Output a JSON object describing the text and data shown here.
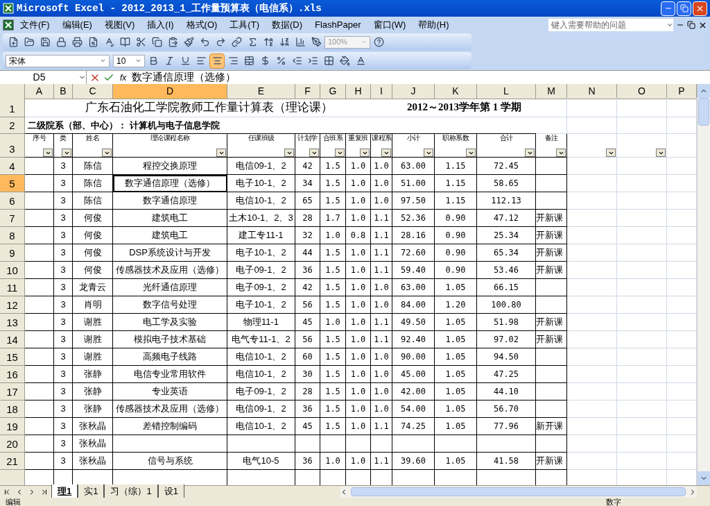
{
  "window": {
    "title": "Microsoft Excel - 2012_2013_1_工作量预算表（电信系）.xls"
  },
  "menu": [
    "文件(F)",
    "编辑(E)",
    "视图(V)",
    "插入(I)",
    "格式(O)",
    "工具(T)",
    "数据(D)",
    "FlashPaper",
    "窗口(W)",
    "帮助(H)"
  ],
  "help_search": {
    "placeholder": "键入需要帮助的问题"
  },
  "standard_toolbar": {
    "zoom": "100%"
  },
  "format_toolbar": {
    "font": "宋体",
    "size": "10",
    "buttons": [
      {
        "kind": "bold",
        "selected": false
      },
      {
        "kind": "italic",
        "selected": false
      },
      {
        "kind": "underline",
        "selected": false
      },
      {
        "kind": "align-left",
        "selected": false
      },
      {
        "kind": "align-center",
        "selected": true
      },
      {
        "kind": "align-right",
        "selected": false
      },
      {
        "kind": "merge",
        "selected": false
      },
      {
        "kind": "currency",
        "selected": false
      },
      {
        "kind": "percent",
        "selected": false
      },
      {
        "kind": "outdent",
        "selected": false
      },
      {
        "kind": "indent",
        "selected": false
      },
      {
        "kind": "borders",
        "selected": false
      },
      {
        "kind": "fill-color",
        "selected": false
      },
      {
        "kind": "font-color",
        "selected": false
      }
    ]
  },
  "formula_bar": {
    "name_box": "D5",
    "fx": "fx",
    "formula": "数字通信原理（选修）"
  },
  "columns": [
    {
      "label": "A",
      "selected": false
    },
    {
      "label": "B",
      "selected": false
    },
    {
      "label": "C",
      "selected": false
    },
    {
      "label": "D",
      "selected": true
    },
    {
      "label": "E",
      "selected": false
    },
    {
      "label": "F",
      "selected": false
    },
    {
      "label": "G",
      "selected": false
    },
    {
      "label": "H",
      "selected": false
    },
    {
      "label": "I",
      "selected": false
    },
    {
      "label": "J",
      "selected": false
    },
    {
      "label": "K",
      "selected": false
    },
    {
      "label": "L",
      "selected": false
    },
    {
      "label": "M",
      "selected": false
    },
    {
      "label": "N",
      "selected": false
    },
    {
      "label": "O",
      "selected": false
    },
    {
      "label": "P",
      "selected": false
    }
  ],
  "title_row": {
    "row": "1",
    "selected": false,
    "title": "广东石油化工学院教师工作量计算表（理论课）",
    "term": "2012～2013学年第 1 学期"
  },
  "department_row": {
    "row": "2",
    "selected": false,
    "text": "二级院系（部、中心）： 计算机与电子信息学院"
  },
  "header_row": {
    "row": "3",
    "selected": false,
    "cells": [
      {
        "text": "序号",
        "filter": true
      },
      {
        "text": "类",
        "filter": true
      },
      {
        "text": "姓名",
        "filter": true
      },
      {
        "text": "理论课程名称",
        "filter": true
      },
      {
        "text": "任课班级",
        "filter": true
      },
      {
        "text": "计划学",
        "filter": true
      },
      {
        "text": "合班系",
        "filter": true
      },
      {
        "text": "重复班",
        "filter": true
      },
      {
        "text": "课程系",
        "filter": true
      },
      {
        "text": "小计",
        "filter": true
      },
      {
        "text": "职称系数",
        "filter": true
      },
      {
        "text": "合计",
        "filter": true
      },
      {
        "text": "备注",
        "filter": true
      },
      {
        "filter": true
      },
      {
        "filter": true
      },
      {
        "filter": false
      }
    ]
  },
  "rows": [
    {
      "row": "4",
      "selected": false,
      "cells": {
        "B": "3",
        "C": "陈信",
        "D": "程控交换原理",
        "E": "电信09-1、2",
        "F": "42",
        "G": "1.5",
        "H": "1.0",
        "I": "1.0",
        "J": "63.00",
        "K": "1.15",
        "L": "72.45"
      }
    },
    {
      "row": "5",
      "selected": true,
      "cells": {
        "B": "3",
        "C": "陈信",
        "D": "数字通信原理（选修）",
        "E": "电子10-1、2",
        "F": "34",
        "G": "1.5",
        "H": "1.0",
        "I": "1.0",
        "J": "51.00",
        "K": "1.15",
        "L": "58.65"
      }
    },
    {
      "row": "6",
      "selected": false,
      "cells": {
        "B": "3",
        "C": "陈信",
        "D": "数字通信原理",
        "E": "电信10-1、2",
        "F": "65",
        "G": "1.5",
        "H": "1.0",
        "I": "1.0",
        "J": "97.50",
        "K": "1.15",
        "L": "112.13"
      }
    },
    {
      "row": "7",
      "selected": false,
      "cells": {
        "B": "3",
        "C": "何俊",
        "D": "建筑电工",
        "E": "土木10-1、2、3",
        "F": "28",
        "G": "1.7",
        "H": "1.0",
        "I": "1.1",
        "J": "52.36",
        "K": "0.90",
        "L": "47.12",
        "M": "开新课"
      }
    },
    {
      "row": "8",
      "selected": false,
      "cells": {
        "B": "3",
        "C": "何俊",
        "D": "建筑电工",
        "E": "建工专11-1",
        "F": "32",
        "G": "1.0",
        "H": "0.8",
        "I": "1.1",
        "J": "28.16",
        "K": "0.90",
        "L": "25.34",
        "M": "开新课"
      }
    },
    {
      "row": "9",
      "selected": false,
      "cells": {
        "B": "3",
        "C": "何俊",
        "D": "DSP系统设计与开发",
        "E": "电子10-1、2",
        "F": "44",
        "G": "1.5",
        "H": "1.0",
        "I": "1.1",
        "J": "72.60",
        "K": "0.90",
        "L": "65.34",
        "M": "开新课"
      }
    },
    {
      "row": "10",
      "selected": false,
      "cells": {
        "B": "3",
        "C": "何俊",
        "D": "传感器技术及应用（选修）",
        "E": "电子09-1、2",
        "F": "36",
        "G": "1.5",
        "H": "1.0",
        "I": "1.1",
        "J": "59.40",
        "K": "0.90",
        "L": "53.46",
        "M": "开新课"
      }
    },
    {
      "row": "11",
      "selected": false,
      "cells": {
        "B": "3",
        "C": "龙青云",
        "D": "光纤通信原理",
        "E": "电子09-1、2",
        "F": "42",
        "G": "1.5",
        "H": "1.0",
        "I": "1.0",
        "J": "63.00",
        "K": "1.05",
        "L": "66.15"
      }
    },
    {
      "row": "12",
      "selected": false,
      "cells": {
        "B": "3",
        "C": "肖明",
        "D": "数字信号处理",
        "E": "电子10-1、2",
        "F": "56",
        "G": "1.5",
        "H": "1.0",
        "I": "1.0",
        "J": "84.00",
        "K": "1.20",
        "L": "100.80"
      }
    },
    {
      "row": "13",
      "selected": false,
      "cells": {
        "B": "3",
        "C": "谢胜",
        "D": "电工学及实验",
        "E": "物理11-1",
        "F": "45",
        "G": "1.0",
        "H": "1.0",
        "I": "1.1",
        "J": "49.50",
        "K": "1.05",
        "L": "51.98",
        "M": "开新课"
      }
    },
    {
      "row": "14",
      "selected": false,
      "cells": {
        "B": "3",
        "C": "谢胜",
        "D": "模拟电子技术基础",
        "E": "电气专11-1、2",
        "F": "56",
        "G": "1.5",
        "H": "1.0",
        "I": "1.1",
        "J": "92.40",
        "K": "1.05",
        "L": "97.02",
        "M": "开新课"
      }
    },
    {
      "row": "15",
      "selected": false,
      "cells": {
        "B": "3",
        "C": "谢胜",
        "D": "高频电子线路",
        "E": "电信10-1、2",
        "F": "60",
        "G": "1.5",
        "H": "1.0",
        "I": "1.0",
        "J": "90.00",
        "K": "1.05",
        "L": "94.50"
      }
    },
    {
      "row": "16",
      "selected": false,
      "cells": {
        "B": "3",
        "C": "张静",
        "D": "电信专业常用软件",
        "E": "电信10-1、2",
        "F": "30",
        "G": "1.5",
        "H": "1.0",
        "I": "1.0",
        "J": "45.00",
        "K": "1.05",
        "L": "47.25"
      }
    },
    {
      "row": "17",
      "selected": false,
      "cells": {
        "B": "3",
        "C": "张静",
        "D": "专业英语",
        "E": "电子09-1、2",
        "F": "28",
        "G": "1.5",
        "H": "1.0",
        "I": "1.0",
        "J": "42.00",
        "K": "1.05",
        "L": "44.10"
      }
    },
    {
      "row": "18",
      "selected": false,
      "cells": {
        "B": "3",
        "C": "张静",
        "D": "传感器技术及应用（选修）",
        "E": "电信09-1、2",
        "F": "36",
        "G": "1.5",
        "H": "1.0",
        "I": "1.0",
        "J": "54.00",
        "K": "1.05",
        "L": "56.70"
      }
    },
    {
      "row": "19",
      "selected": false,
      "cells": {
        "B": "3",
        "C": "张秋晶",
        "D": "差错控制编码",
        "E": "电信10-1、2",
        "F": "45",
        "G": "1.5",
        "H": "1.0",
        "I": "1.1",
        "J": "74.25",
        "K": "1.05",
        "L": "77.96",
        "M": "新开课"
      }
    },
    {
      "row": "20",
      "selected": false,
      "cells": {
        "B": "3",
        "C": "张秋晶"
      }
    },
    {
      "row": "21",
      "selected": false,
      "cells": {
        "B": "3",
        "C": "张秋晶",
        "D": "信号与系统",
        "E": "电气10-5",
        "F": "36",
        "G": "1.0",
        "H": "1.0",
        "I": "1.1",
        "J": "39.60",
        "K": "1.05",
        "L": "41.58",
        "M": "开新课"
      }
    }
  ],
  "sheet_tabs": [
    {
      "label": "理1",
      "selected": true
    },
    {
      "label": "实1",
      "selected": false
    },
    {
      "label": "习（综）1",
      "selected": false
    },
    {
      "label": "设1",
      "selected": false
    }
  ],
  "status_bar": {
    "mode": "编辑",
    "indicator": "数字"
  }
}
